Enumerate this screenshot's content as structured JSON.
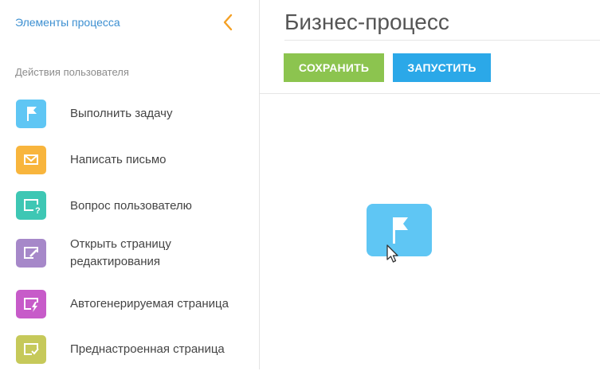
{
  "sidebar": {
    "title": "Элементы процесса",
    "section_label": "Действия пользователя",
    "items": [
      {
        "label": "Выполнить задачу",
        "icon": "flag-icon",
        "color": "#5fc6f4"
      },
      {
        "label": "Написать письмо",
        "icon": "envelope-icon",
        "color": "#f8b53d"
      },
      {
        "label": "Вопрос пользователю",
        "icon": "question-window-icon",
        "color": "#3ec7b4"
      },
      {
        "label_line1": "Открыть страницу",
        "label_line2": "редактирования",
        "icon": "edit-page-icon",
        "color": "#a688c9"
      },
      {
        "label": "Автогенерируемая страница",
        "icon": "lightning-page-icon",
        "color": "#c75bc9"
      },
      {
        "label": "Преднастроенная страница",
        "icon": "check-page-icon",
        "color": "#c6c95a"
      }
    ]
  },
  "main": {
    "title": "Бизнес-процесс",
    "save_label": "СОХРАНИТЬ",
    "run_label": "ЗАПУСТИТЬ",
    "canvas_node_icon": "flag-icon"
  },
  "colors": {
    "accent_link": "#3c8fd1",
    "collapse_arrow": "#f4a024",
    "save_button": "#8cc44f",
    "run_button": "#2ba8e8"
  }
}
